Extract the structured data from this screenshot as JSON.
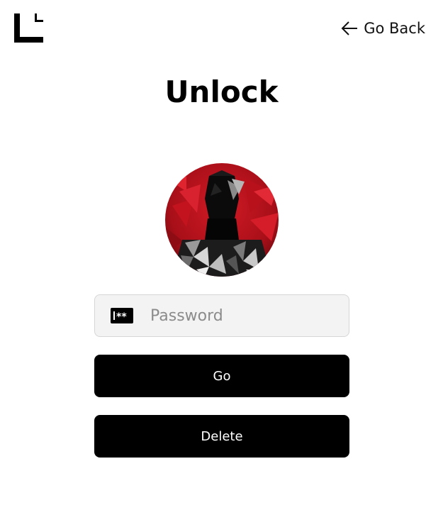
{
  "header": {
    "logo_icon": "brand-corner-logo-icon",
    "back_icon": "arrow-left-icon",
    "back_label": "Go Back"
  },
  "main": {
    "title": "Unlock",
    "avatar_icon": "user-avatar-geometric",
    "password": {
      "icon": "password-key-icon",
      "placeholder": "Password",
      "value": ""
    },
    "go_label": "Go",
    "delete_label": "Delete"
  },
  "colors": {
    "background": "#ffffff",
    "button_bg": "#000000",
    "button_text": "#ffffff",
    "input_bg": "#f3f3f3",
    "input_border": "#d6d6d6",
    "placeholder": "#8b8b8b",
    "avatar_red": "#c0141f"
  }
}
